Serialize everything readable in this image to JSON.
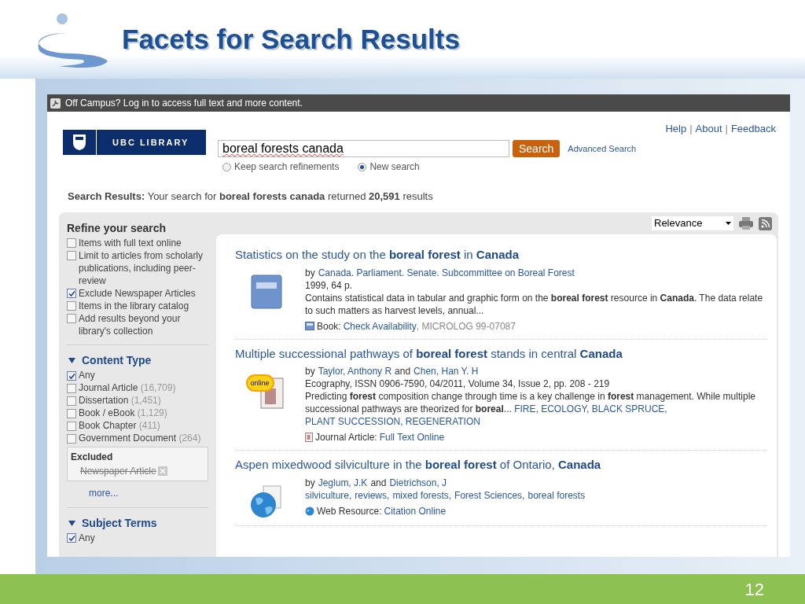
{
  "slide": {
    "title": "Facets for Search Results",
    "page_number": "12"
  },
  "notice_bar": {
    "text": "Off Campus? Log in to access full text and more content."
  },
  "header": {
    "logo_text": "UBC LIBRARY",
    "links": [
      {
        "kind": "link",
        "text": "Help"
      },
      {
        "kind": "separator",
        "text": "|"
      },
      {
        "kind": "link",
        "text": "About"
      },
      {
        "kind": "separator",
        "text": "|"
      },
      {
        "kind": "link",
        "text": "Feedback"
      }
    ],
    "search_value": "boreal forests canada",
    "search_button": "Search",
    "advanced_link": "Advanced Search",
    "radios": [
      {
        "label": "Keep search refinements",
        "selected": false
      },
      {
        "label": "New search",
        "selected": true
      }
    ]
  },
  "summary": {
    "label": "Search Results:",
    "text": "Your search for **boreal forests canada** returned **20,591** results"
  },
  "sort": {
    "value": "Relevance"
  },
  "refine": {
    "title": "Refine your search",
    "options": [
      {
        "label": "Items with full text online",
        "checked": false
      },
      {
        "label": "Limit to articles from scholarly publications, including peer-review",
        "checked": false
      },
      {
        "label": "Exclude Newspaper Articles",
        "checked": true
      },
      {
        "label": "Items in the library catalog",
        "checked": false
      },
      {
        "label": "Add results beyond your library's collection",
        "checked": false
      }
    ]
  },
  "content_type": {
    "title": "Content Type",
    "expanded": true,
    "options": [
      {
        "label": "Any",
        "checked": true
      },
      {
        "label": "Journal Article",
        "count": "(16,709)",
        "checked": false
      },
      {
        "label": "Dissertation",
        "count": "(1,451)",
        "checked": false
      },
      {
        "label": "Book / eBook",
        "count": "(1,129)",
        "checked": false
      },
      {
        "label": "Book Chapter",
        "count": "(411)",
        "checked": false
      },
      {
        "label": "Government Document",
        "count": "(264)",
        "checked": false
      }
    ],
    "excluded_title": "Excluded",
    "excluded": [
      "Newspaper Article"
    ],
    "more": "more..."
  },
  "subject_terms": {
    "title": "Subject Terms",
    "expanded": true,
    "options": [
      {
        "label": "Any",
        "checked": true
      }
    ]
  },
  "results": [
    {
      "kind": "book",
      "title": "Statistics on the study on the **boreal forest** in **Canada**",
      "byline": [
        {
          "kind": "text",
          "text": "by"
        },
        {
          "kind": "link",
          "text": "Canada. Parliament. Senate. Subcommittee on Boreal Forest"
        }
      ],
      "details": "1999, 64 p.",
      "description": "Contains statistical data in tabular and graphic form on the **boreal forest** resource in **Canada**. The data relate to such matters as harvest levels, annual...",
      "format_label": "Book:",
      "format_link": "Check Availability",
      "format_extra": ", MICROLOG 99-07087"
    },
    {
      "kind": "article",
      "title": "Multiple successional pathways of **boreal forest** stands in central **Canada**",
      "badge": "online",
      "byline": [
        {
          "kind": "text",
          "text": "by"
        },
        {
          "kind": "link",
          "text": "Taylor, Anthony R"
        },
        {
          "kind": "text",
          "text": "and"
        },
        {
          "kind": "link",
          "text": "Chen, Han Y. H"
        }
      ],
      "details": "Ecography, ISSN 0906-7590, 04/2011, Volume 34, Issue 2, pp. 208 - 219",
      "description": "Predicting **forest** composition change through time is a key challenge in **forest** management. While multiple successional pathways are theorized for **boreal**...",
      "subjects": [
        "FIRE,",
        "ECOLOGY,",
        "BLACK SPRUCE,",
        "PLANT SUCCESSION,",
        "REGENERATION"
      ],
      "format_label": "Journal Article:",
      "format_link": "Full Text Online"
    },
    {
      "kind": "web",
      "title": "Aspen mixedwood silviculture in the **boreal forest** of Ontario, **Canada**",
      "byline": [
        {
          "kind": "text",
          "text": "by"
        },
        {
          "kind": "link",
          "text": "Jeglum, J.K"
        },
        {
          "kind": "text",
          "text": "and"
        },
        {
          "kind": "link",
          "text": "Dietrichson, J"
        }
      ],
      "subjects": [
        "silviculture,",
        "reviews,",
        "mixed forests,",
        "Forest Sciences,",
        "boreal forests"
      ],
      "format_label": "Web Resource:",
      "format_link": "Citation Online"
    }
  ]
}
